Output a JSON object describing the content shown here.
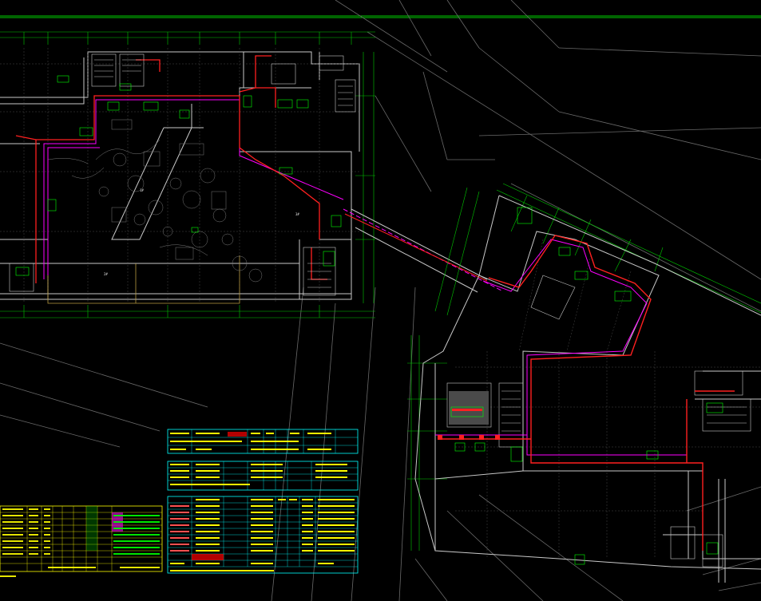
{
  "drawing": {
    "background": "#000000",
    "colors": {
      "wall": "#c8c8c8",
      "grid_green": "#00c800",
      "pipe_red": "#ff2020",
      "pipe_magenta": "#ff00ff",
      "equip_green": "#00ff00",
      "table_cyan": "#00ffff",
      "table_yellow": "#ffff00",
      "furniture": "#8a8a8a",
      "gold": "#b89a40"
    },
    "room_labels": [
      "1#",
      "2#",
      "3#"
    ],
    "tables": [
      {
        "name": "equipment-schedule-left",
        "color": "yellow",
        "rows": 10
      },
      {
        "name": "equipment-schedule-top",
        "color": "cyan",
        "rows": 3
      },
      {
        "name": "equipment-schedule-mid",
        "color": "cyan",
        "rows": 4
      },
      {
        "name": "equipment-schedule-main",
        "color": "cyan",
        "rows": 11
      }
    ]
  }
}
